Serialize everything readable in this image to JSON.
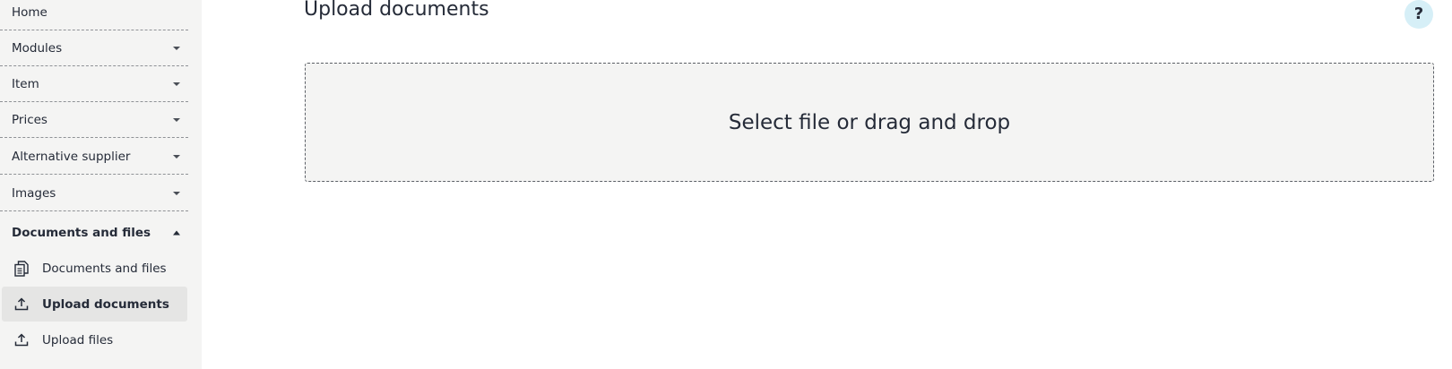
{
  "sidebar": {
    "items": [
      {
        "label": "Home",
        "icon": "none"
      },
      {
        "label": "Modules",
        "icon": "chevron-down-icon"
      },
      {
        "label": "Item",
        "icon": "chevron-down-icon"
      },
      {
        "label": "Prices",
        "icon": "chevron-down-icon"
      },
      {
        "label": "Alternative supplier",
        "icon": "chevron-down-icon"
      },
      {
        "label": "Images",
        "icon": "chevron-down-icon"
      },
      {
        "label": "Documents and files",
        "icon": "chevron-up-icon",
        "expanded": true
      }
    ],
    "subitems": [
      {
        "label": "Documents and files",
        "icon": "document-icon",
        "active": false
      },
      {
        "label": "Upload documents",
        "icon": "upload-icon",
        "active": true
      },
      {
        "label": "Upload files",
        "icon": "upload-icon",
        "active": false
      }
    ]
  },
  "main": {
    "title": "Upload documents",
    "help_label": "?",
    "dropzone_text": "Select file or drag and drop"
  },
  "colors": {
    "sidebar_background": "#f4f4f3",
    "active_item_background": "#e5e5e4",
    "text": "#252b38",
    "help_button_background": "#d6eff7",
    "dropzone_background": "#f4f4f3"
  }
}
